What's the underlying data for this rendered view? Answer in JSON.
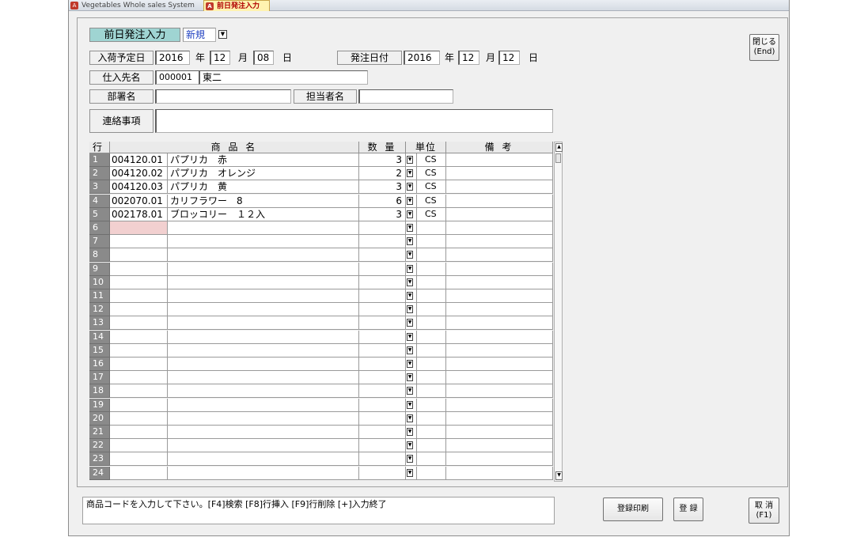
{
  "tabs": [
    {
      "label": "Vegetables Whole sales System"
    },
    {
      "label": "前日発注入力"
    }
  ],
  "form": {
    "title": "前日発注入力",
    "mode": "新規",
    "arrival_label": "入荷予定日",
    "arrival_year": "2016",
    "arrival_month": "12",
    "arrival_day": "08",
    "order_label": "発注日付",
    "order_year": "2016",
    "order_month": "12",
    "order_day": "12",
    "year_unit": "年",
    "month_unit": "月",
    "day_unit": "日",
    "supplier_label": "仕入先名",
    "supplier_code": "000001",
    "supplier_name": "東二",
    "dept_label": "部署名",
    "dept_value": "",
    "person_label": "担当者名",
    "person_value": "",
    "notes_label": "連絡事項",
    "notes_value": ""
  },
  "buttons": {
    "close": "閉じる\n(End)",
    "register_print": "登録印刷",
    "register": "登 録",
    "cancel": "取 消\n(F1)"
  },
  "grid": {
    "headers": [
      "行",
      "商 品 名",
      "数 量",
      "単位",
      "備 考"
    ],
    "rows": [
      {
        "no": "1",
        "code": "004120.01",
        "name": "パプリカ　赤",
        "qty": "3",
        "unit": "CS",
        "note": ""
      },
      {
        "no": "2",
        "code": "004120.02",
        "name": "パプリカ　オレンジ",
        "qty": "2",
        "unit": "CS",
        "note": ""
      },
      {
        "no": "3",
        "code": "004120.03",
        "name": "パプリカ　黄",
        "qty": "3",
        "unit": "CS",
        "note": ""
      },
      {
        "no": "4",
        "code": "002070.01",
        "name": "カリフラワー　8",
        "qty": "6",
        "unit": "CS",
        "note": ""
      },
      {
        "no": "5",
        "code": "002178.01",
        "name": "ブロッコリー　１２入",
        "qty": "3",
        "unit": "CS",
        "note": ""
      },
      {
        "no": "6",
        "code": "",
        "name": "",
        "qty": "",
        "unit": "",
        "note": ""
      },
      {
        "no": "7",
        "code": "",
        "name": "",
        "qty": "",
        "unit": "",
        "note": ""
      },
      {
        "no": "8",
        "code": "",
        "name": "",
        "qty": "",
        "unit": "",
        "note": ""
      },
      {
        "no": "9",
        "code": "",
        "name": "",
        "qty": "",
        "unit": "",
        "note": ""
      },
      {
        "no": "10",
        "code": "",
        "name": "",
        "qty": "",
        "unit": "",
        "note": ""
      },
      {
        "no": "11",
        "code": "",
        "name": "",
        "qty": "",
        "unit": "",
        "note": ""
      },
      {
        "no": "12",
        "code": "",
        "name": "",
        "qty": "",
        "unit": "",
        "note": ""
      },
      {
        "no": "13",
        "code": "",
        "name": "",
        "qty": "",
        "unit": "",
        "note": ""
      },
      {
        "no": "14",
        "code": "",
        "name": "",
        "qty": "",
        "unit": "",
        "note": ""
      },
      {
        "no": "15",
        "code": "",
        "name": "",
        "qty": "",
        "unit": "",
        "note": ""
      },
      {
        "no": "16",
        "code": "",
        "name": "",
        "qty": "",
        "unit": "",
        "note": ""
      },
      {
        "no": "17",
        "code": "",
        "name": "",
        "qty": "",
        "unit": "",
        "note": ""
      },
      {
        "no": "18",
        "code": "",
        "name": "",
        "qty": "",
        "unit": "",
        "note": ""
      },
      {
        "no": "19",
        "code": "",
        "name": "",
        "qty": "",
        "unit": "",
        "note": ""
      },
      {
        "no": "20",
        "code": "",
        "name": "",
        "qty": "",
        "unit": "",
        "note": ""
      },
      {
        "no": "21",
        "code": "",
        "name": "",
        "qty": "",
        "unit": "",
        "note": ""
      },
      {
        "no": "22",
        "code": "",
        "name": "",
        "qty": "",
        "unit": "",
        "note": ""
      },
      {
        "no": "23",
        "code": "",
        "name": "",
        "qty": "",
        "unit": "",
        "note": ""
      },
      {
        "no": "24",
        "code": "",
        "name": "",
        "qty": "",
        "unit": "",
        "note": ""
      }
    ]
  },
  "status": {
    "message": "商品コードを入力して下さい。[F4]検索 [F8]行挿入 [F9]行削除 [+]入力終了"
  }
}
